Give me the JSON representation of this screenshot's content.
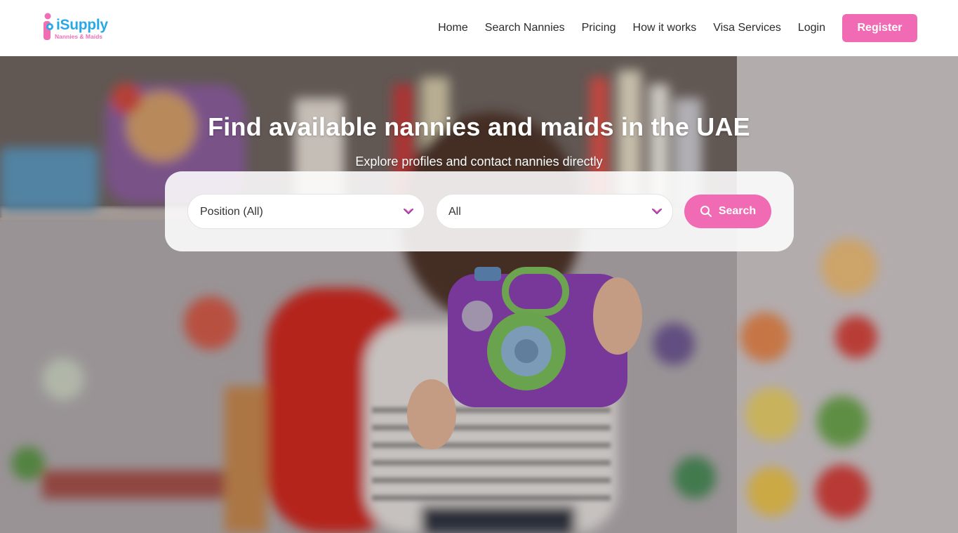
{
  "brand": {
    "name": "iSupply",
    "tagline": "Nannies & Maids",
    "colors": {
      "primary": "#29a8e8",
      "accent": "#f06bb3"
    }
  },
  "nav": {
    "items": [
      {
        "label": "Home"
      },
      {
        "label": "Search Nannies"
      },
      {
        "label": "Pricing"
      },
      {
        "label": "How it works"
      },
      {
        "label": "Visa Services"
      },
      {
        "label": "Login"
      }
    ],
    "register_label": "Register"
  },
  "hero": {
    "title": "Find available nannies and maids in the UAE",
    "subtitle": "Explore profiles and contact nannies directly",
    "background": "photo-toddler-with-toy-camera"
  },
  "search": {
    "position_select": {
      "value": "Position (All)",
      "icon": "chevron-down-icon"
    },
    "location_select": {
      "value": "All",
      "icon": "chevron-down-icon"
    },
    "button_label": "Search",
    "button_icon": "search-icon"
  }
}
